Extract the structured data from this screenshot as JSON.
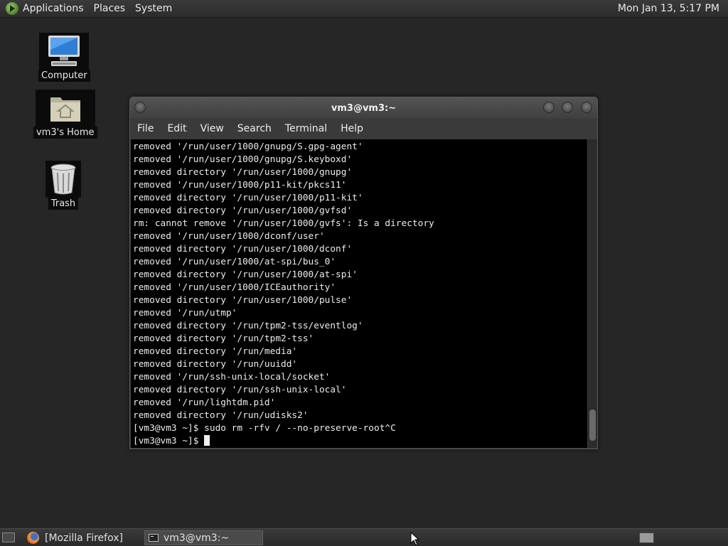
{
  "top_panel": {
    "menus": [
      "Applications",
      "Places",
      "System"
    ],
    "clock": "Mon Jan 13,  5:17 PM"
  },
  "desktop": {
    "icons": [
      {
        "label": "Computer",
        "icon": "computer-icon"
      },
      {
        "label": "vm3's Home",
        "icon": "home-folder-icon"
      },
      {
        "label": "Trash",
        "icon": "trash-icon"
      }
    ]
  },
  "window": {
    "title": "vm3@vm3:~",
    "menus": [
      "File",
      "Edit",
      "View",
      "Search",
      "Terminal",
      "Help"
    ],
    "terminal_lines": [
      "removed '/run/user/1000/gnupg/S.gpg-agent'",
      "removed '/run/user/1000/gnupg/S.keyboxd'",
      "removed directory '/run/user/1000/gnupg'",
      "removed '/run/user/1000/p11-kit/pkcs11'",
      "removed directory '/run/user/1000/p11-kit'",
      "removed directory '/run/user/1000/gvfsd'",
      "rm: cannot remove '/run/user/1000/gvfs': Is a directory",
      "removed '/run/user/1000/dconf/user'",
      "removed directory '/run/user/1000/dconf'",
      "removed '/run/user/1000/at-spi/bus_0'",
      "removed directory '/run/user/1000/at-spi'",
      "removed '/run/user/1000/ICEauthority'",
      "removed directory '/run/user/1000/pulse'",
      "removed '/run/utmp'",
      "removed directory '/run/tpm2-tss/eventlog'",
      "removed directory '/run/tpm2-tss'",
      "removed directory '/run/media'",
      "removed directory '/run/uuidd'",
      "removed '/run/ssh-unix-local/socket'",
      "removed directory '/run/ssh-unix-local'",
      "removed '/run/lightdm.pid'",
      "removed directory '/run/udisks2'",
      "[vm3@vm3 ~]$ sudo rm -rfv / --no-preserve-root^C"
    ],
    "prompt": "[vm3@vm3 ~]$ "
  },
  "taskbar": {
    "tasks": [
      {
        "label": "[Mozilla Firefox]",
        "icon": "firefox-icon",
        "active": false
      },
      {
        "label": "vm3@vm3:~",
        "icon": "terminal-icon",
        "active": true
      }
    ]
  }
}
